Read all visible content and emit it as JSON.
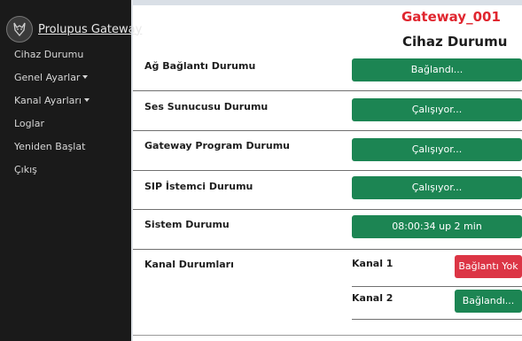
{
  "brand": {
    "name": "Prolupus Gateway",
    "logo_icon": "wolf-logo-icon"
  },
  "nav": {
    "items": [
      {
        "label": "Cihaz Durumu"
      },
      {
        "label": "Genel Ayarlar",
        "dropdown": true
      },
      {
        "label": "Kanal Ayarları",
        "dropdown": true
      },
      {
        "label": "Loglar"
      },
      {
        "label": "Yeniden Başlat"
      },
      {
        "label": "Çıkış"
      }
    ]
  },
  "header": {
    "gateway_name": "Gateway_001",
    "page_title": "Cihaz Durumu"
  },
  "status": {
    "network": {
      "label": "Ağ Bağlantı Durumu",
      "value": "Bağlandı..."
    },
    "voice_server": {
      "label": "Ses Sunucusu Durumu",
      "value": "Çalışıyor..."
    },
    "gateway_program": {
      "label": "Gateway Program Durumu",
      "value": "Çalışıyor..."
    },
    "sip_client": {
      "label": "SIP İstemci Durumu",
      "value": "Çalışıyor..."
    },
    "system": {
      "label": "Sistem Durumu",
      "value": "08:00:34 up 2 min"
    }
  },
  "channels": {
    "label": "Kanal Durumları",
    "items": [
      {
        "name": "Kanal 1",
        "value": "Bağlantı Yok"
      },
      {
        "name": "Kanal 2",
        "value": "Bağlandı..."
      }
    ]
  },
  "colors": {
    "sidebar": "#1a1a1a",
    "success": "#1c8553",
    "danger": "#dc3545",
    "gateway_title": "#e0262f"
  }
}
